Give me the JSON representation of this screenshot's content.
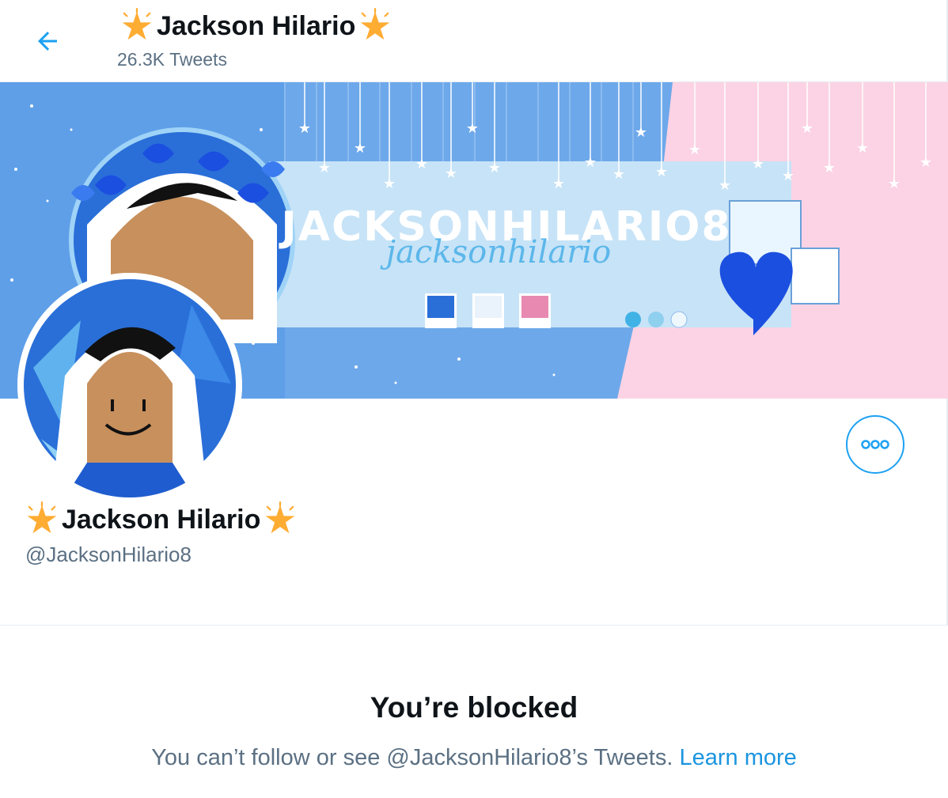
{
  "header": {
    "back_icon": "arrow-left-icon",
    "title": "Jackson Hilario",
    "tweet_count": "26.3K Tweets",
    "title_emoji": "star-icon"
  },
  "banner": {
    "banner_text": "JACKSONHILARIO8",
    "banner_script_text": "jacksonhilario",
    "colors": {
      "blue": "#6da8ea",
      "light_blue": "#c7e3f7",
      "pink": "#fbd3e4",
      "dark_blue": "#1b4fe0"
    }
  },
  "profile": {
    "display_name": "Jackson Hilario",
    "handle": "@JacksonHilario8",
    "more_icon": "more-horizontal-icon"
  },
  "blocked": {
    "title": "You’re blocked",
    "desc_prefix": "You can’t follow or see @JacksonHilario8’s Tweets. ",
    "learn_more": "Learn more"
  },
  "colors": {
    "accent": "#1da1f2",
    "text": "#0f1419",
    "secondary": "#5b7083",
    "star": "#ffac33"
  }
}
